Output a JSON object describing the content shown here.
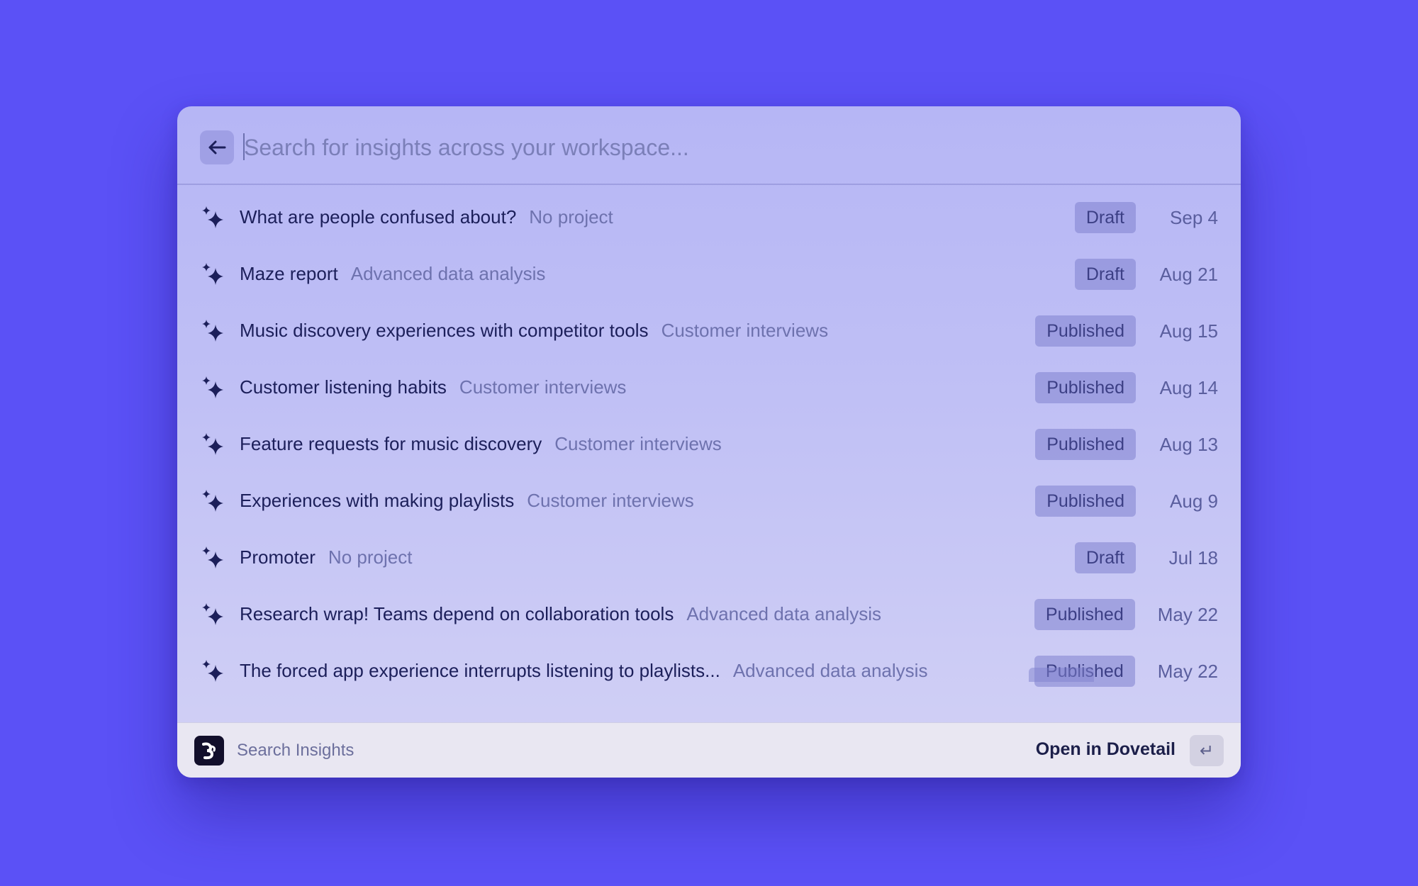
{
  "search": {
    "placeholder": "Search for insights across your workspace...",
    "back_icon": "arrow-left-icon"
  },
  "results": [
    {
      "title": "What are people confused about?",
      "project": "No project",
      "status": "Draft",
      "date": "Sep 4"
    },
    {
      "title": "Maze report",
      "project": "Advanced data analysis",
      "status": "Draft",
      "date": "Aug 21"
    },
    {
      "title": "Music discovery experiences with competitor tools",
      "project": "Customer interviews",
      "status": "Published",
      "date": "Aug 15"
    },
    {
      "title": "Customer listening habits",
      "project": "Customer interviews",
      "status": "Published",
      "date": "Aug 14"
    },
    {
      "title": "Feature requests for music discovery",
      "project": "Customer interviews",
      "status": "Published",
      "date": "Aug 13"
    },
    {
      "title": "Experiences with making playlists",
      "project": "Customer interviews",
      "status": "Published",
      "date": "Aug 9"
    },
    {
      "title": "Promoter",
      "project": "No project",
      "status": "Draft",
      "date": "Jul 18"
    },
    {
      "title": "Research wrap! Teams depend on collaboration tools",
      "project": "Advanced data analysis",
      "status": "Published",
      "date": "May 22"
    },
    {
      "title": "The forced app experience interrupts listening to playlists...",
      "project": "Advanced data analysis",
      "status": "Published",
      "date": "May 22"
    }
  ],
  "footer": {
    "label": "Search Insights",
    "open_label": "Open in Dovetail",
    "enter_symbol": "↵"
  },
  "colors": {
    "background": "#5b51f6",
    "title_text": "#1c1f5a",
    "project_text": "#6e72ae",
    "badge_bg": "#8082cd"
  }
}
